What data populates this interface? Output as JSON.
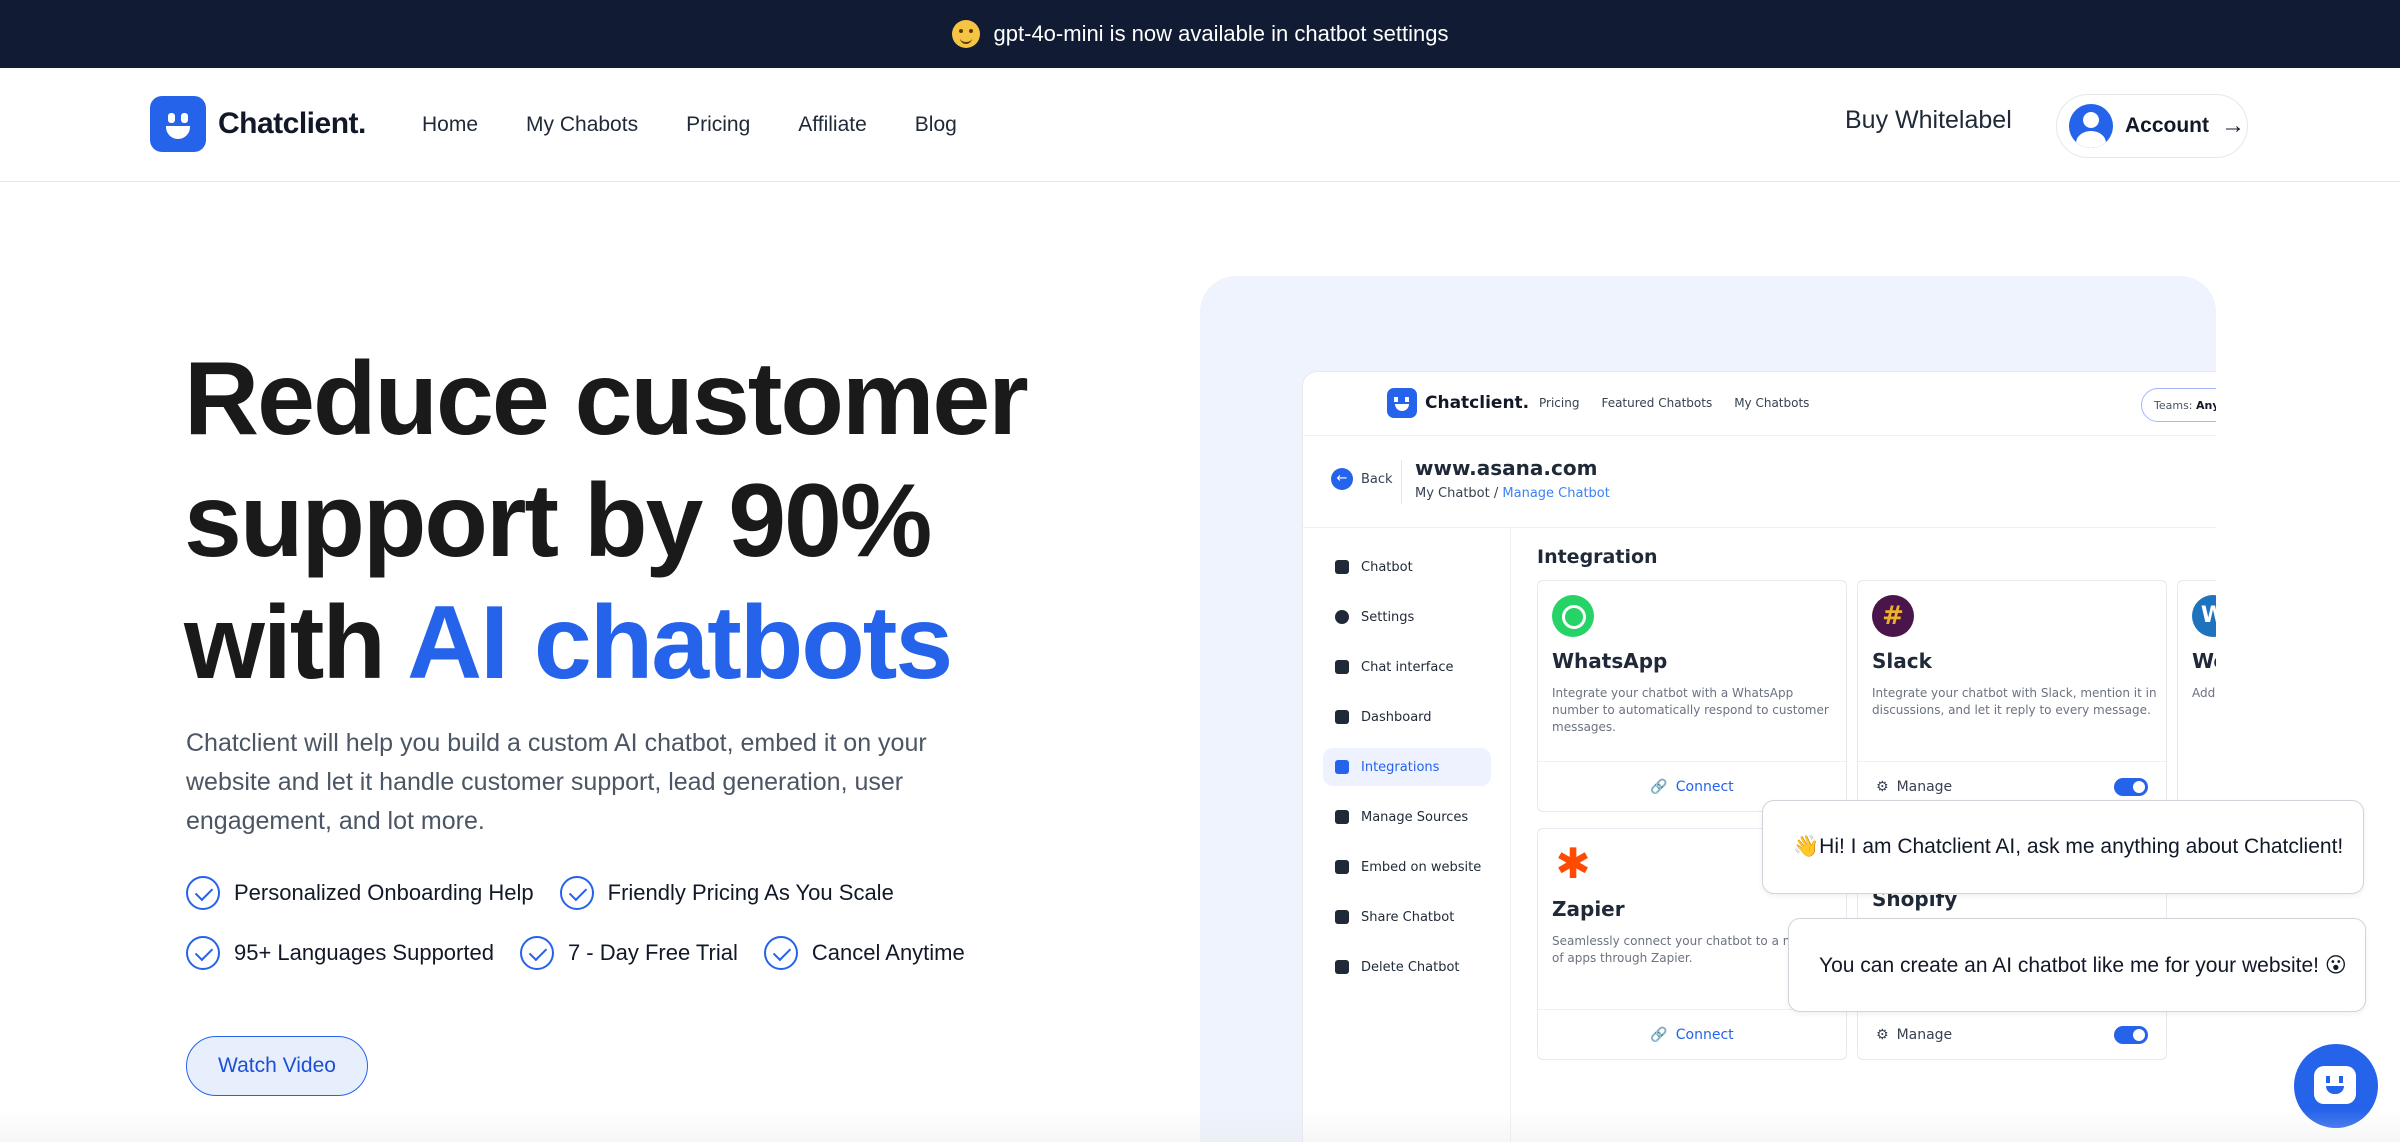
{
  "announcement": {
    "text": "gpt-4o-mini is now available in chatbot settings",
    "emoji": "party-face"
  },
  "nav": {
    "brand": "Chatclient.",
    "links": [
      "Home",
      "My Chabots",
      "Pricing",
      "Affiliate",
      "Blog"
    ],
    "whitelabel": "Buy Whitelabel",
    "account": "Account"
  },
  "hero": {
    "title_line1": "Reduce customer",
    "title_line2": "support by 90%",
    "title_line3_prefix": "with ",
    "title_line3_accent": "AI chatbots",
    "description": "Chatclient will help you build a custom AI chatbot, embed it on your website and let it handle customer support, lead generation, user engagement, and lot more.",
    "features_row1": [
      "Personalized Onboarding Help",
      "Friendly Pricing As You Scale"
    ],
    "features_row2": [
      "95+ Languages Supported",
      "7 - Day Free Trial",
      "Cancel Anytime"
    ],
    "watch_video": "Watch Video"
  },
  "preview": {
    "brand": "Chatclient.",
    "nav": [
      "Pricing",
      "Featured Chatbots",
      "My Chatbots"
    ],
    "teams_label": "Teams:",
    "teams_value": "Any",
    "back": "Back",
    "site": "www.asana.com",
    "crumb_parent": "My Chatbot /",
    "crumb_current": "Manage Chatbot",
    "sidebar": [
      "Chatbot",
      "Settings",
      "Chat interface",
      "Dashboard",
      "Integrations",
      "Manage Sources",
      "Embed on website",
      "Share Chatbot",
      "Delete Chatbot"
    ],
    "section_title": "Integration",
    "cards": [
      {
        "name": "WhatsApp",
        "desc": "Integrate your chatbot with a WhatsApp number to automatically respond to customer messages.",
        "action": "Connect"
      },
      {
        "name": "Slack",
        "desc": "Integrate your chatbot with Slack, mention it in discussions, and let it reply to every message.",
        "action": "Manage"
      },
      {
        "name": "Wo",
        "desc": "Add effo plu",
        "action": ""
      },
      {
        "name": "Zapier",
        "desc": "Seamlessly connect your chatbot to a network of apps through Zapier.",
        "action": "Connect"
      },
      {
        "name": "Shopify",
        "desc": "",
        "action": "Manage"
      }
    ]
  },
  "chat": {
    "bubble1": "👋Hi! I am Chatclient AI, ask me anything about Chatclient!",
    "bubble2": "You can create an AI chatbot like me for your website! 😮"
  },
  "colors": {
    "accent": "#2563eb",
    "announcement_bg": "#111c34",
    "preview_bg": "#eef3fd"
  }
}
